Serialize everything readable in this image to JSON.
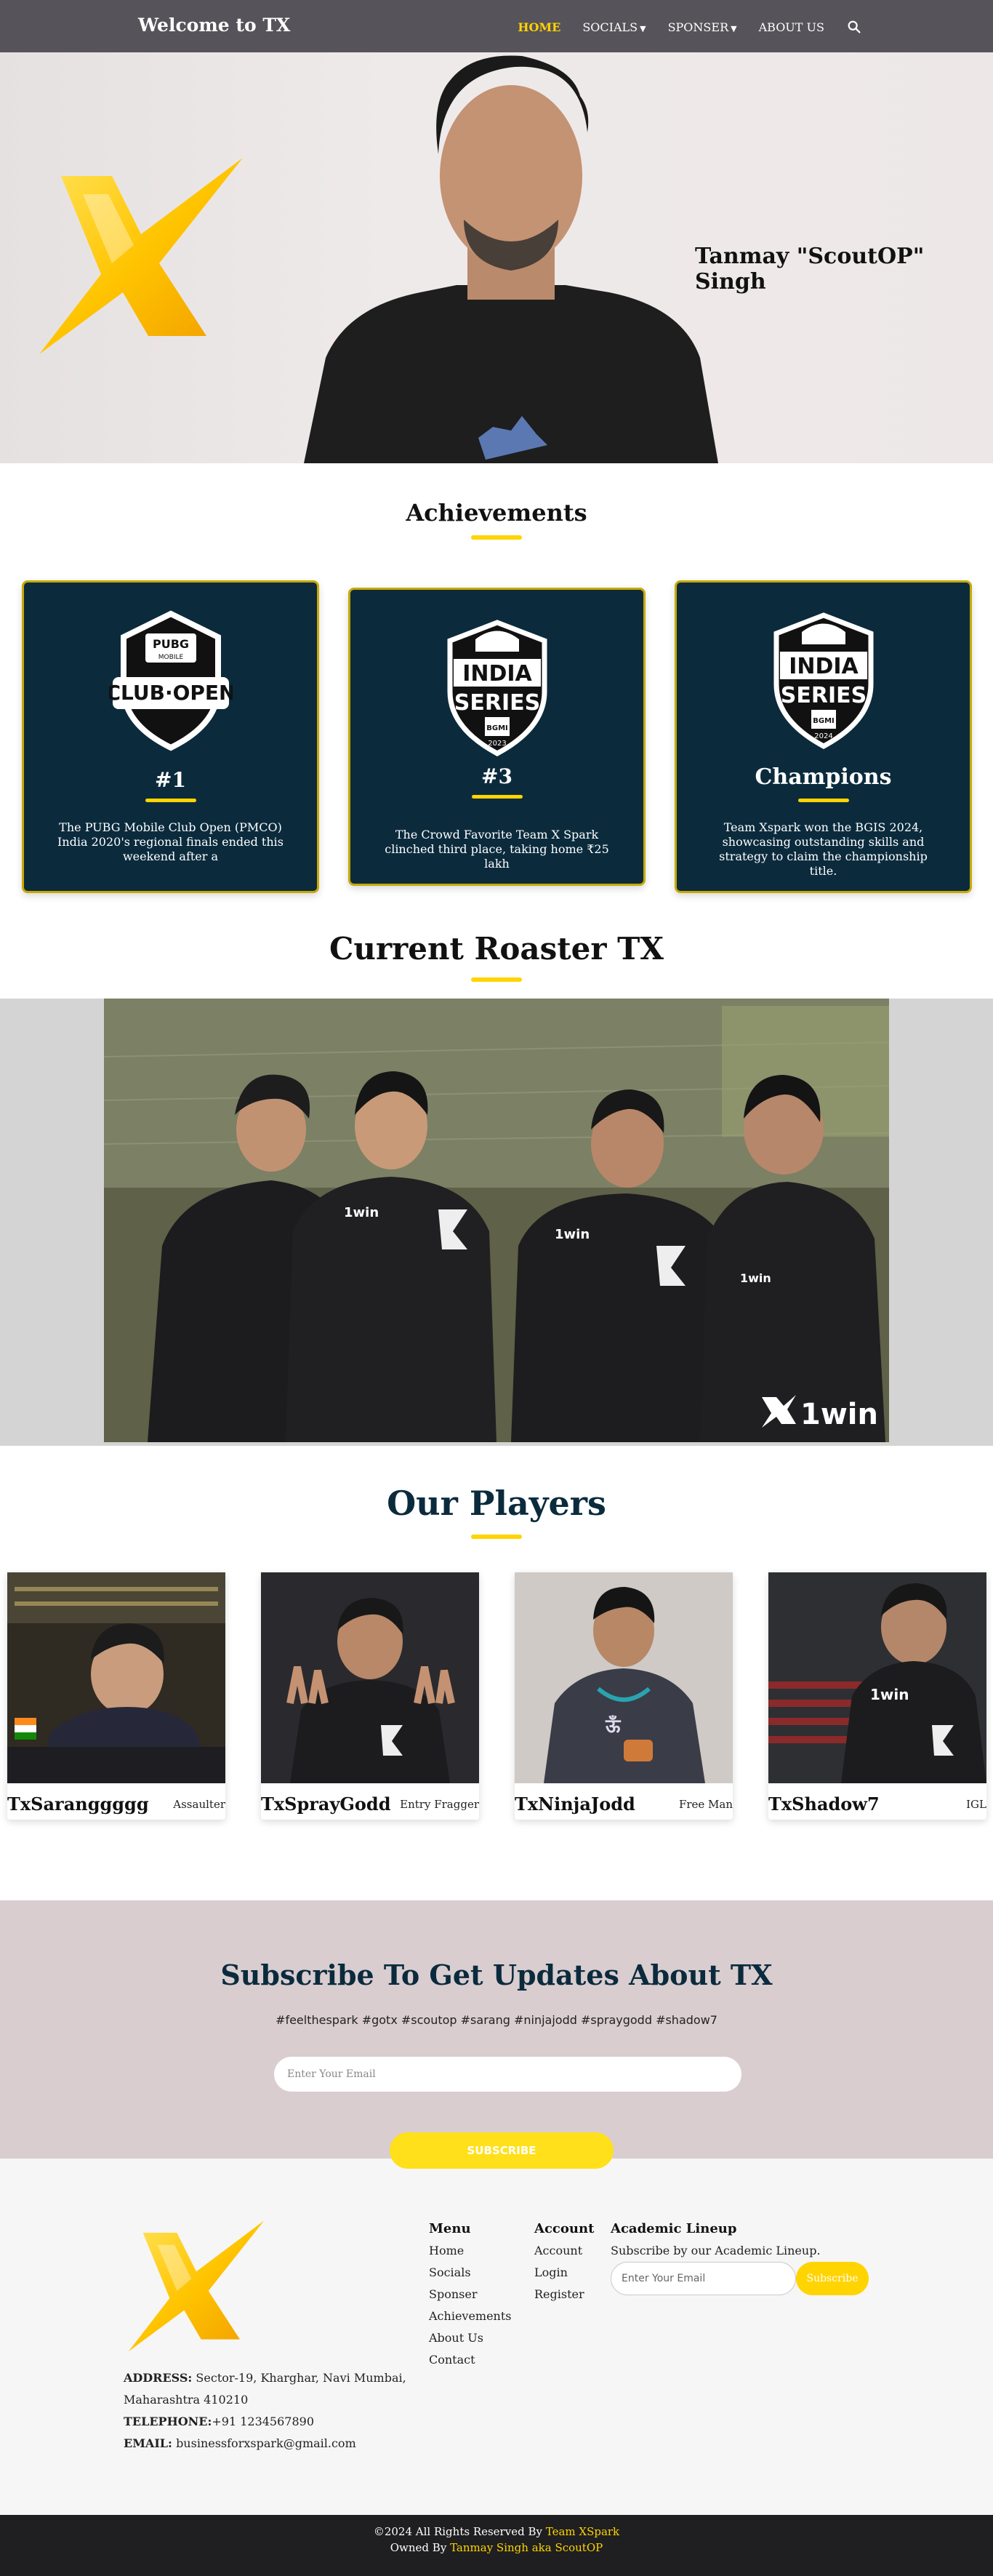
{
  "nav": {
    "brand": "Welcome to TX",
    "links": [
      "HOME",
      "SOCIALS",
      "SPONSER",
      "ABOUT US"
    ]
  },
  "hero": {
    "name": "Tanmay \"ScoutOP\" Singh"
  },
  "achievements": {
    "title": "Achievements",
    "cards": [
      {
        "badge": "PUBG MOBILE CLUB OPEN",
        "title": "#1",
        "text": "The PUBG Mobile Club Open (PMCO) India 2020's regional finals ended this weekend after a"
      },
      {
        "badge": "INDIA SERIES 2023",
        "title": "#3",
        "text": "The Crowd Favorite Team X Spark clinched third place, taking home ₹25 lakh"
      },
      {
        "badge": "INDIA SERIES 2024",
        "title": "Champions",
        "text": "Team Xspark won the BGIS 2024, showcasing outstanding skills and strategy to claim the championship title."
      }
    ]
  },
  "roster": {
    "title": "Current Roaster TX",
    "sponsor": "1win"
  },
  "players": {
    "title": "Our Players",
    "list": [
      {
        "name": "TxSaranggggg",
        "role": "Assaulter"
      },
      {
        "name": "TxSprayGodd",
        "role": "Entry Fragger"
      },
      {
        "name": "TxNinjaJodd",
        "role": "Free Man"
      },
      {
        "name": "TxShadow7",
        "role": "IGL"
      }
    ]
  },
  "subscribe": {
    "title": "Subscribe To Get Updates About TX",
    "tags": "#feelthespark #gotx #scoutop #sarang #ninjajodd #spraygodd #shadow7",
    "placeholder": "Enter Your Email",
    "button": "SUBSCRIBE"
  },
  "footer": {
    "address_label": "ADDRESS:",
    "address_line1": "Sector-19, Kharghar, Navi Mumbai,",
    "address_line2": "Maharashtra 410210",
    "telephone_label": "TELEPHONE:",
    "telephone": "+91 1234567890",
    "email_label": "EMAIL:",
    "email": "businessforxspark@gmail.com",
    "menu": {
      "title": "Menu",
      "items": [
        "Home",
        "Socials",
        "Sponser",
        "Achievements",
        "About Us",
        "Contact"
      ]
    },
    "account": {
      "title": "Account",
      "items": [
        "Account",
        "Login",
        "Register"
      ]
    },
    "lineup": {
      "title": "Academic Lineup",
      "text": "Subscribe by our Academic Lineup.",
      "placeholder": "Enter Your Email",
      "button": "Subscribe"
    }
  },
  "copyright": {
    "prefix": "©2024 All Rights Reserved By",
    "team": "Team XSpark",
    "owned": "Owned By",
    "owner": "Tanmay Singh aka ScoutOP"
  },
  "colors": {
    "accent": "#ffd400",
    "nav_bg": "#57535a",
    "card_bg": "#0b2b3d",
    "subscribe_bg": "#d9cdd0"
  }
}
